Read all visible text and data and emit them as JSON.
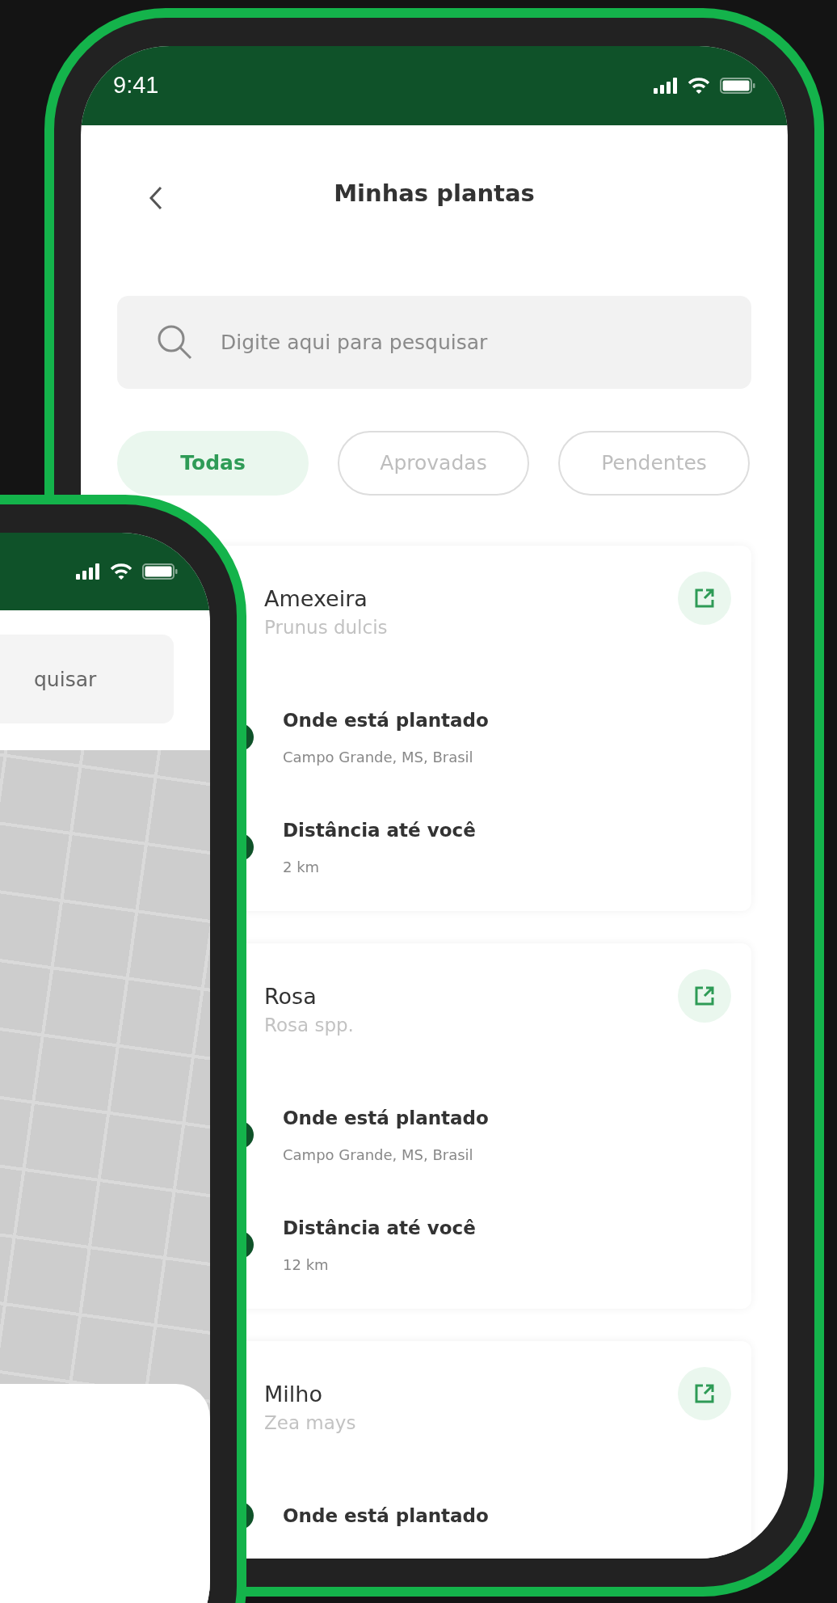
{
  "back_phone": {
    "status_bar": {
      "time": "9:41"
    },
    "header": {
      "title": "Minhas plantas"
    },
    "search": {
      "placeholder": "Digite aqui para pesquisar"
    },
    "filters": [
      {
        "label": "Todas",
        "selected": true
      },
      {
        "label": "Aprovadas",
        "selected": false
      },
      {
        "label": "Pendentes",
        "selected": false
      }
    ],
    "plants": [
      {
        "name": "Amexeira",
        "scientific_name": "Prunus dulcis",
        "details": [
          {
            "label": "Onde está plantado",
            "value": "Campo Grande, MS, Brasil"
          },
          {
            "label": "Distância até você",
            "value": "2 km"
          }
        ]
      },
      {
        "name": "Rosa",
        "scientific_name": "Rosa spp.",
        "details": [
          {
            "label": "Onde está plantado",
            "value": "Campo Grande, MS, Brasil"
          },
          {
            "label": "Distância até você",
            "value": "12 km"
          }
        ]
      },
      {
        "name": "Milho",
        "scientific_name": "Zea mays",
        "details": [
          {
            "label": "Onde está plantado"
          }
        ]
      }
    ]
  },
  "front_phone": {
    "search": {
      "placeholder": "quisar"
    }
  }
}
